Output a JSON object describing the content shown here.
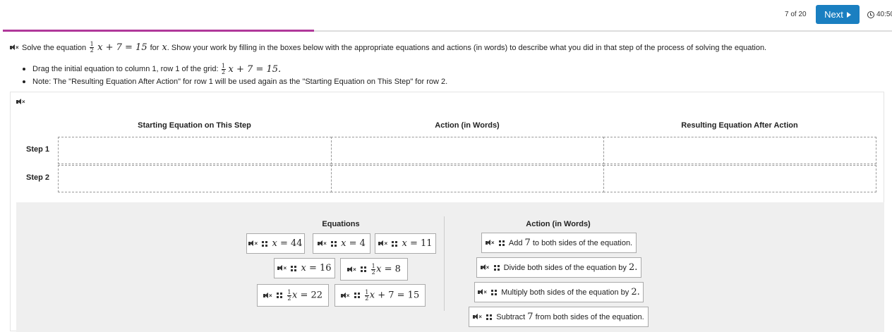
{
  "header": {
    "counter": "7 of 20",
    "next_label": "Next",
    "timer": "40:50"
  },
  "progress": {
    "fraction": 0.35
  },
  "question": {
    "prefix": "Solve the equation",
    "equation": "x + 7 = 15",
    "for_text": "for",
    "var": "x",
    "suffix": ". Show your work by filling in the boxes below with the appropriate equations and actions (in words) to describe what you did in that step of the process of solving the equation."
  },
  "bullets": [
    {
      "text": "Drag the initial equation to column 1, row 1 of the grid:",
      "equation": "x + 7 = 15."
    },
    {
      "text": "Note: The \"Resulting Equation After Action\" for row 1 will be used again as the \"Starting Equation on This Step\" for row 2."
    }
  ],
  "grid": {
    "columns": [
      "Starting Equation on This Step",
      "Action (in Words)",
      "Resulting Equation After Action"
    ],
    "rows": [
      "Step 1",
      "Step 2"
    ]
  },
  "tray": {
    "equations_heading": "Equations",
    "actions_heading": "Action (in Words)",
    "equations": [
      {
        "var": "x",
        "rest": "= 44"
      },
      {
        "var": "x",
        "rest": "= 4"
      },
      {
        "var": "x",
        "rest": "= 11"
      },
      {
        "var": "x",
        "rest": "= 16"
      },
      {
        "frac": true,
        "var": "x",
        "rest": "= 8"
      },
      {
        "frac": true,
        "var": "x",
        "rest": "= 22"
      },
      {
        "frac": true,
        "var": "x",
        "rest": "+ 7 = 15"
      }
    ],
    "actions": [
      {
        "before": "Add",
        "num": "7",
        "after": "to both sides of the equation."
      },
      {
        "before": "Divide both sides of the equation by",
        "num": "2.",
        "after": ""
      },
      {
        "before": "Multiply both sides of the equation by",
        "num": "2.",
        "after": ""
      },
      {
        "before": "Subtract",
        "num": "7",
        "after": "from both sides of the equation."
      }
    ]
  },
  "icons": {
    "speaker": "speaker-muted-icon",
    "grip": "drag-handle-icon",
    "clock": "clock-icon",
    "next": "play-arrow-icon"
  },
  "colors": {
    "accent": "#1a7fc1",
    "progress": "#b0389a",
    "tray": "#efefef"
  }
}
